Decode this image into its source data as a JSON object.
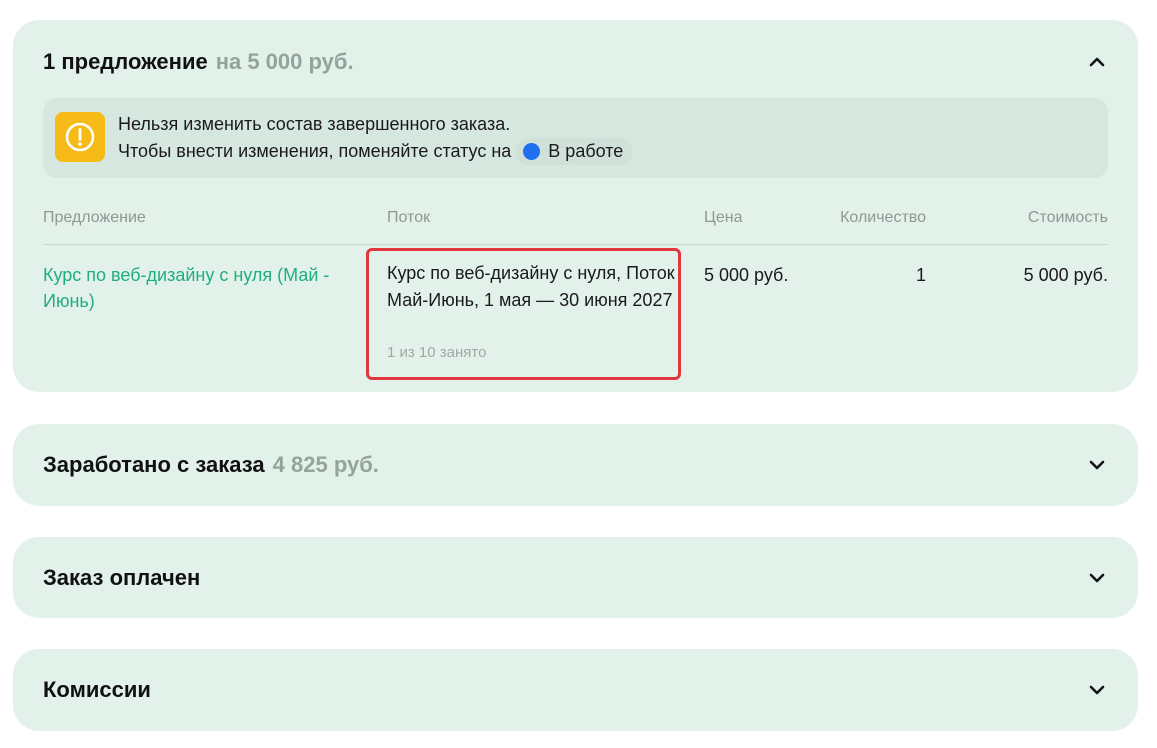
{
  "offers_panel": {
    "title": "1 предложение",
    "amount": "на 5 000 руб.",
    "expanded": true,
    "alert": {
      "icon": "exclamation-circle-icon",
      "line1": "Нельзя изменить состав завершенного заказа.",
      "line2": "Чтобы внести изменения, поменяйте статус на",
      "status_label": "В работе",
      "status_color": "#1f6ff0"
    },
    "columns": [
      "Предложение",
      "Поток",
      "Цена",
      "Количество",
      "Стоимость"
    ],
    "rows": [
      {
        "offer": "Курс по веб-дизайну с нуля (Май - Июнь)",
        "stream": "Курс по веб-дизайну с нуля, Поток Май-Июнь, 1 мая — 30 июня 2027",
        "stream_occupancy": "1 из 10 занято",
        "price": "5 000 руб.",
        "quantity": "1",
        "cost": "5 000 руб."
      }
    ]
  },
  "earned_panel": {
    "title": "Заработано с заказа",
    "amount": "4 825 руб.",
    "expanded": false
  },
  "paid_panel": {
    "title": "Заказ оплачен",
    "expanded": false
  },
  "commission_panel": {
    "title": "Комиссии",
    "expanded": false
  },
  "colors": {
    "panel_bg": "#e2f2ea",
    "link": "#1fae7e",
    "muted": "#94a39c",
    "alert_icon": "#f7bb18",
    "highlight_border": "#e0373c"
  }
}
